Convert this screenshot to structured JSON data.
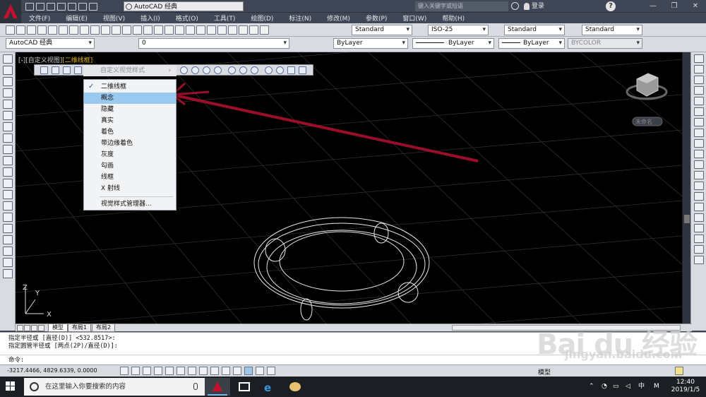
{
  "titlebar": {
    "workspace": "AutoCAD 经典",
    "search_placeholder": "键入关键字或短语",
    "login": "登录",
    "help": "?"
  },
  "menubar": [
    "文件(F)",
    "编辑(E)",
    "视图(V)",
    "插入(I)",
    "格式(O)",
    "工具(T)",
    "绘图(D)",
    "标注(N)",
    "修改(M)",
    "参数(P)",
    "窗口(W)",
    "帮助(H)"
  ],
  "toolbar2": {
    "text_style": "Standard",
    "dim_style": "ISO-25",
    "table_style": "Standard",
    "mleader_style": "Standard"
  },
  "toolbar3": {
    "workspace": "AutoCAD 经典",
    "layer": "0",
    "color": "ByLayer",
    "linetype": "ByLayer",
    "lineweight": "ByLayer",
    "plotstyle": "BYCOLOR"
  },
  "viewport": {
    "label_prefix": "[-][自定义视图]",
    "label_style": "[二维线框]",
    "viewcube_label": "未命名"
  },
  "submenu_header": "自定义视觉样式",
  "visual_styles_menu": {
    "items": [
      "二维线框",
      "概念",
      "隐藏",
      "真实",
      "着色",
      "带边缘着色",
      "灰度",
      "勾画",
      "线框",
      "X 射线"
    ],
    "checked_index": 0,
    "highlighted_index": 1,
    "manager": "视觉样式管理器..."
  },
  "layout_tabs": [
    "模型",
    "布局1",
    "布局2"
  ],
  "command": {
    "history1": "指定半径或 [直径(D)] <532.8517>:",
    "history2": "指定圆管半径或 [两点(2P)/直径(D)]:",
    "prompt": "命令:"
  },
  "status": {
    "coords": "-3217.4466, 4829.6339, 0.0000",
    "model": "模型"
  },
  "taskbar": {
    "search_placeholder": "在这里输入你要搜索的内容",
    "time": "12:40",
    "date": "2019/1/5",
    "ime": "中",
    "ime_mode": "M"
  },
  "watermark": {
    "brand": "Bai du 经验",
    "url": "jingyan.baidu.com"
  },
  "colors": {
    "accent_highlight": "#99c9ef",
    "annotation_arrow": "#9b0e2a",
    "canvas": "#000000"
  }
}
